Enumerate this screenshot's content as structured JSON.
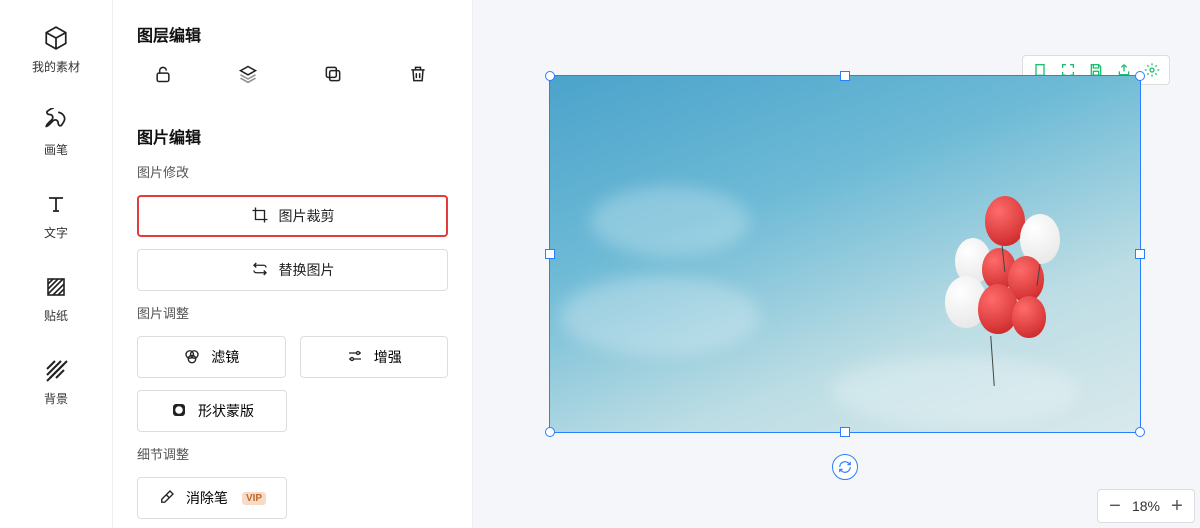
{
  "nav": [
    {
      "name": "materials",
      "label": "我的素材"
    },
    {
      "name": "brush",
      "label": "画笔"
    },
    {
      "name": "text",
      "label": "文字"
    },
    {
      "name": "sticker",
      "label": "贴纸"
    },
    {
      "name": "background",
      "label": "背景"
    }
  ],
  "layer": {
    "title": "图层编辑"
  },
  "image": {
    "title": "图片编辑",
    "modify_sub": "图片修改",
    "crop": "图片裁剪",
    "replace": "替换图片",
    "adjust_sub": "图片调整",
    "filter": "滤镜",
    "enhance": "增强",
    "shape_mask": "形状蒙版",
    "detail_sub": "细节调整",
    "eraser": "消除笔",
    "vip": "VIP"
  },
  "zoom": {
    "level": "18%"
  }
}
